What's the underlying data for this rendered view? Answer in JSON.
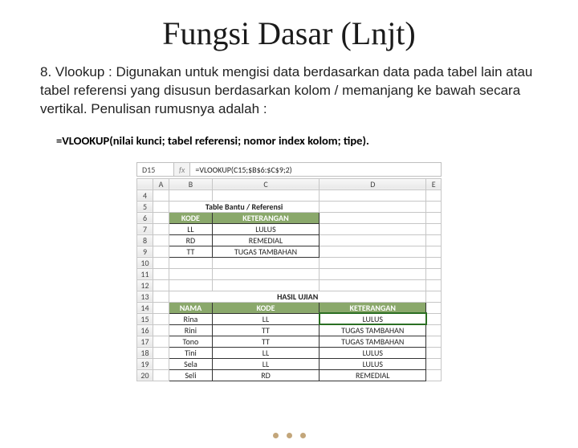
{
  "title": "Fungsi Dasar (Lnjt)",
  "description": "8. Vlookup : Digunakan untuk mengisi data berdasarkan data pada tabel lain atau tabel referensi yang disusun berdasarkan kolom / memanjang ke bawah secara vertikal. Penulisan rumusnya adalah :",
  "formula": "=VLOOKUP(nilai kunci; tabel referensi; nomor index kolom; tipe).",
  "excel": {
    "active_cell": "D15",
    "fx": "fx",
    "formula_bar": "=VLOOKUP(C15;$B$6:$C$9;2)",
    "cols": [
      "",
      "A",
      "B",
      "C",
      "D",
      "E"
    ],
    "ref": {
      "section_row": "5",
      "section_title": "Table Bantu / Referensi",
      "header_row": "6",
      "h1": "KODE",
      "h2": "KETERANGAN",
      "rows": [
        {
          "n": "7",
          "k": "LL",
          "v": "LULUS"
        },
        {
          "n": "8",
          "k": "RD",
          "v": "REMEDIAL"
        },
        {
          "n": "9",
          "k": "TT",
          "v": "TUGAS TAMBAHAN"
        }
      ]
    },
    "blank_rows": [
      "4",
      "10",
      "11",
      "12"
    ],
    "result": {
      "title_row": "13",
      "title": "HASIL UJIAN",
      "header_row": "14",
      "h1": "NAMA",
      "h2": "KODE",
      "h3": "KETERANGAN",
      "rows": [
        {
          "n": "15",
          "a": "Rina",
          "b": "LL",
          "c": "LULUS",
          "sel": true
        },
        {
          "n": "16",
          "a": "Rini",
          "b": "TT",
          "c": "TUGAS TAMBAHAN"
        },
        {
          "n": "17",
          "a": "Tono",
          "b": "TT",
          "c": "TUGAS TAMBAHAN"
        },
        {
          "n": "18",
          "a": "Tini",
          "b": "LL",
          "c": "LULUS"
        },
        {
          "n": "19",
          "a": "Sela",
          "b": "LL",
          "c": "LULUS"
        },
        {
          "n": "20",
          "a": "Seli",
          "b": "RD",
          "c": "REMEDIAL"
        }
      ]
    }
  }
}
